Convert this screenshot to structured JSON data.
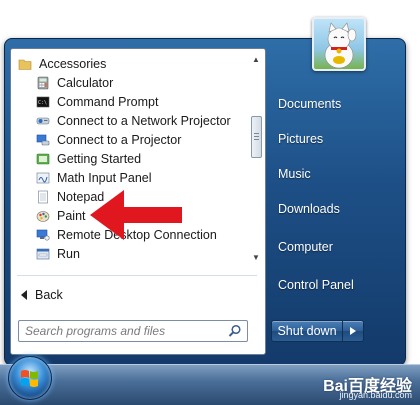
{
  "programs": {
    "folder": {
      "label": "Accessories",
      "icon": "folder-icon"
    },
    "items": [
      {
        "label": "Calculator",
        "icon": "calculator-icon",
        "name": "program-item-calculator"
      },
      {
        "label": "Command Prompt",
        "icon": "command-prompt-icon",
        "name": "program-item-command-prompt"
      },
      {
        "label": "Connect to a Network Projector",
        "icon": "network-projector-icon",
        "name": "program-item-network-projector"
      },
      {
        "label": "Connect to a Projector",
        "icon": "projector-icon",
        "name": "program-item-projector"
      },
      {
        "label": "Getting Started",
        "icon": "getting-started-icon",
        "name": "program-item-getting-started"
      },
      {
        "label": "Math Input Panel",
        "icon": "math-input-icon",
        "name": "program-item-math-input-panel"
      },
      {
        "label": "Notepad",
        "icon": "notepad-icon",
        "name": "program-item-notepad"
      },
      {
        "label": "Paint",
        "icon": "paint-icon",
        "name": "program-item-paint"
      },
      {
        "label": "Remote Desktop Connection",
        "icon": "remote-desktop-icon",
        "name": "program-item-remote-desktop"
      },
      {
        "label": "Run",
        "icon": "run-icon",
        "name": "program-item-run"
      }
    ]
  },
  "back_label": "Back",
  "search": {
    "placeholder": "Search programs and files"
  },
  "right_pane": {
    "items": [
      {
        "label": "Documents",
        "name": "right-item-documents"
      },
      {
        "label": "Pictures",
        "name": "right-item-pictures"
      },
      {
        "label": "Music",
        "name": "right-item-music"
      },
      {
        "label": "Downloads",
        "name": "right-item-downloads"
      },
      {
        "label": "Computer",
        "name": "right-item-computer"
      },
      {
        "label": "Control Panel",
        "name": "right-item-control-panel"
      }
    ]
  },
  "shutdown": {
    "label": "Shut down"
  },
  "watermark": {
    "main": "Bai百度经验",
    "sub": "jingyan.baidu.com"
  },
  "colors": {
    "accent_red": "#e0171f",
    "menu_blue": "#1d4f86"
  }
}
